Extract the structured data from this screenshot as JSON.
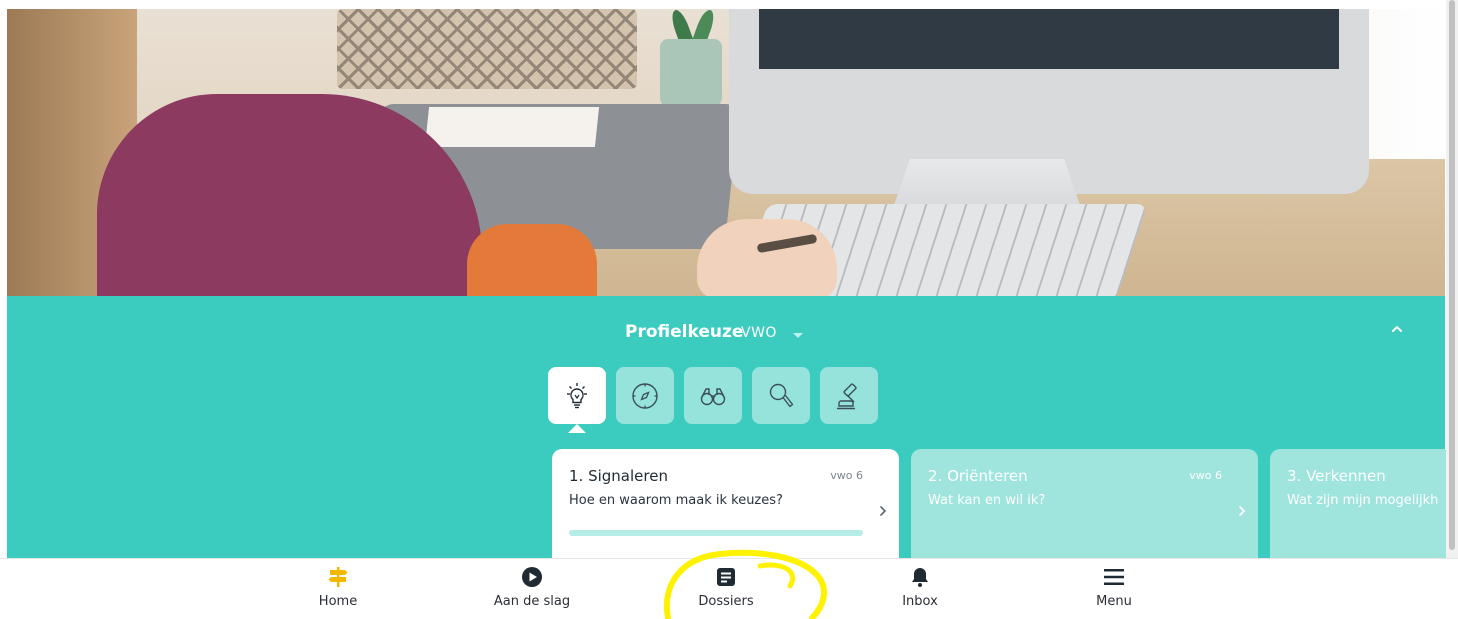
{
  "header": {
    "title": "Profielkeuze",
    "level": "VWO",
    "collapse_icon": "chevron-up-icon"
  },
  "steps": [
    {
      "icon": "lightbulb-icon",
      "active": true
    },
    {
      "icon": "compass-icon",
      "active": false
    },
    {
      "icon": "binoculars-icon",
      "active": false
    },
    {
      "icon": "magnifier-icon",
      "active": false
    },
    {
      "icon": "gavel-icon",
      "active": false
    }
  ],
  "cards": [
    {
      "title": "1. Signaleren",
      "subtitle": "Hoe en waarom maak ik keuzes?",
      "tag": "vwo 6",
      "progress": 0
    },
    {
      "title": "2. Oriënteren",
      "subtitle": "Wat kan en wil ik?",
      "tag": "vwo 6"
    },
    {
      "title": "3. Verkennen",
      "subtitle": "Wat zijn mijn mogelijkh",
      "tag": ""
    }
  ],
  "nav": {
    "items": [
      {
        "label": "Home",
        "icon": "signpost-icon",
        "color": "#f5b800"
      },
      {
        "label": "Aan de slag",
        "icon": "play-circle-icon",
        "color": "#1f2a33"
      },
      {
        "label": "Dossiers",
        "icon": "document-icon",
        "color": "#1f2a33"
      },
      {
        "label": "Inbox",
        "icon": "bell-icon",
        "color": "#1f2a33"
      },
      {
        "label": "Menu",
        "icon": "hamburger-icon",
        "color": "#1f2a33"
      }
    ]
  },
  "colors": {
    "teal": "#3ccbbf",
    "teal_light": "#9fe5de",
    "highlight": "#fff200"
  }
}
